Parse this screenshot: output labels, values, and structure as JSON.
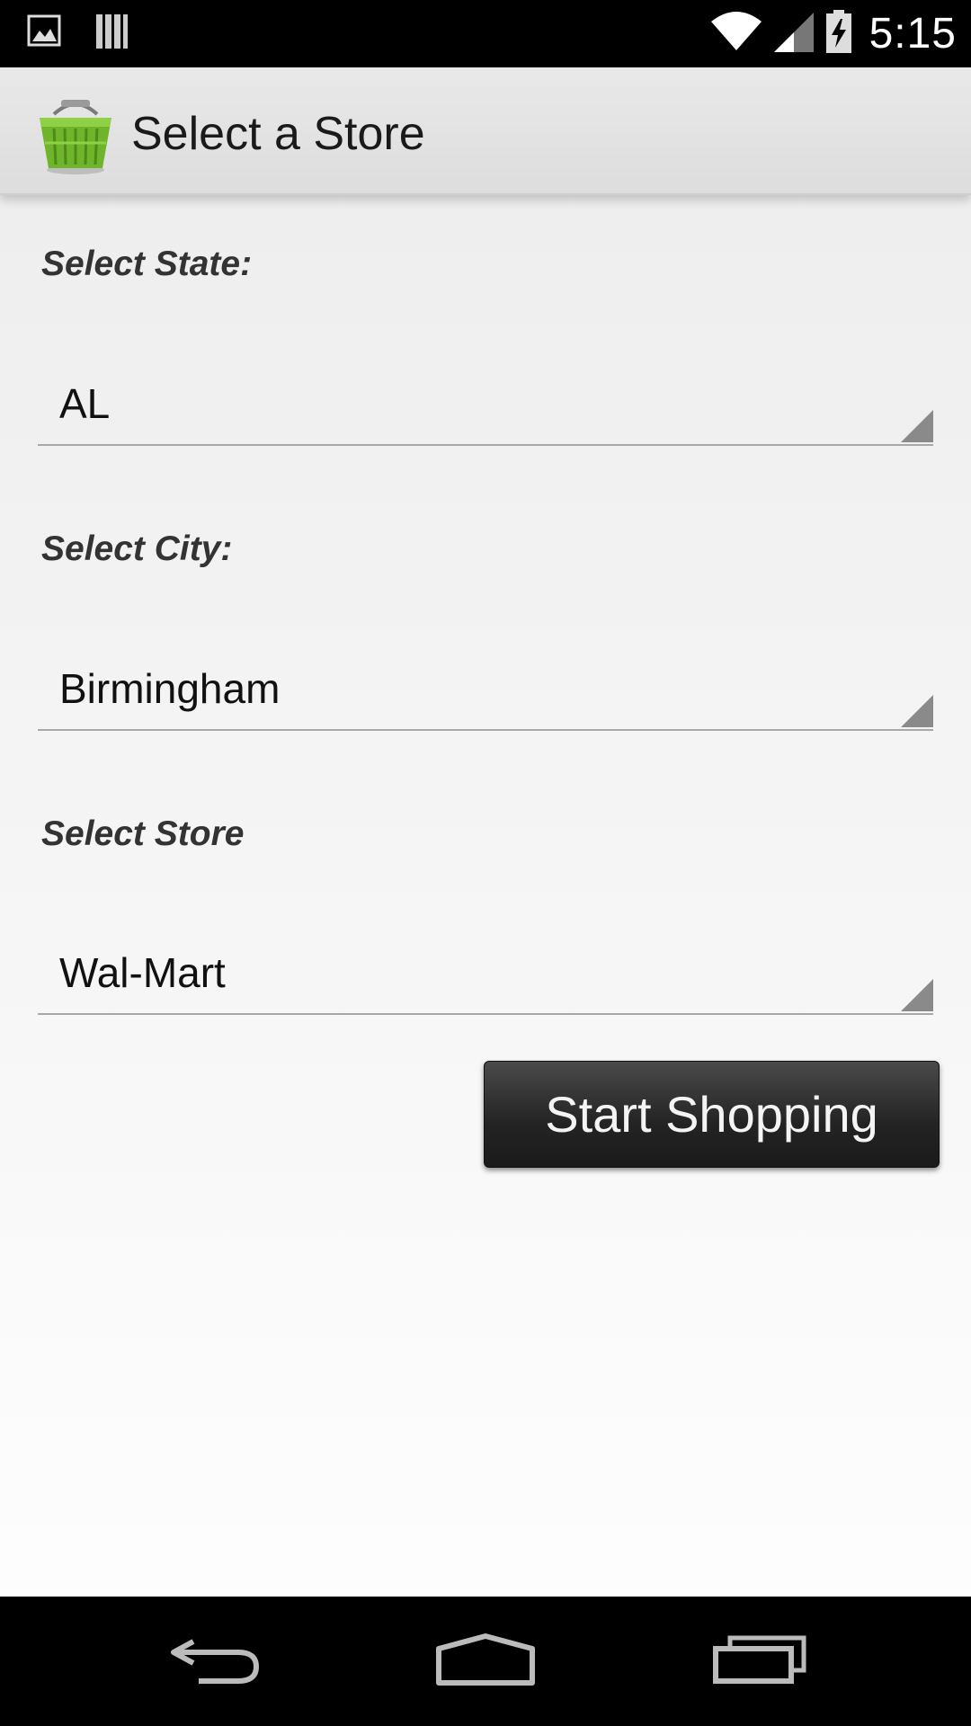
{
  "status_bar": {
    "time": "5:15",
    "icons": [
      "image-notification-icon",
      "storage-notification-icon",
      "wifi-icon",
      "signal-icon",
      "battery-charging-icon"
    ]
  },
  "action_bar": {
    "title": "Select a Store",
    "icon": "shopping-basket-icon"
  },
  "form": {
    "state_label": "Select State:",
    "state_value": "AL",
    "city_label": "Select City:",
    "city_value": "Birmingham",
    "store_label": "Select Store",
    "store_value": "Wal-Mart",
    "start_button_label": "Start Shopping"
  },
  "nav_bar": {
    "icons": [
      "back-icon",
      "home-icon",
      "recent-apps-icon"
    ]
  },
  "colors": {
    "accent_basket": "#6fb52c",
    "spinner_arrow": "#8a8a8a",
    "button_bg": "#262626"
  }
}
